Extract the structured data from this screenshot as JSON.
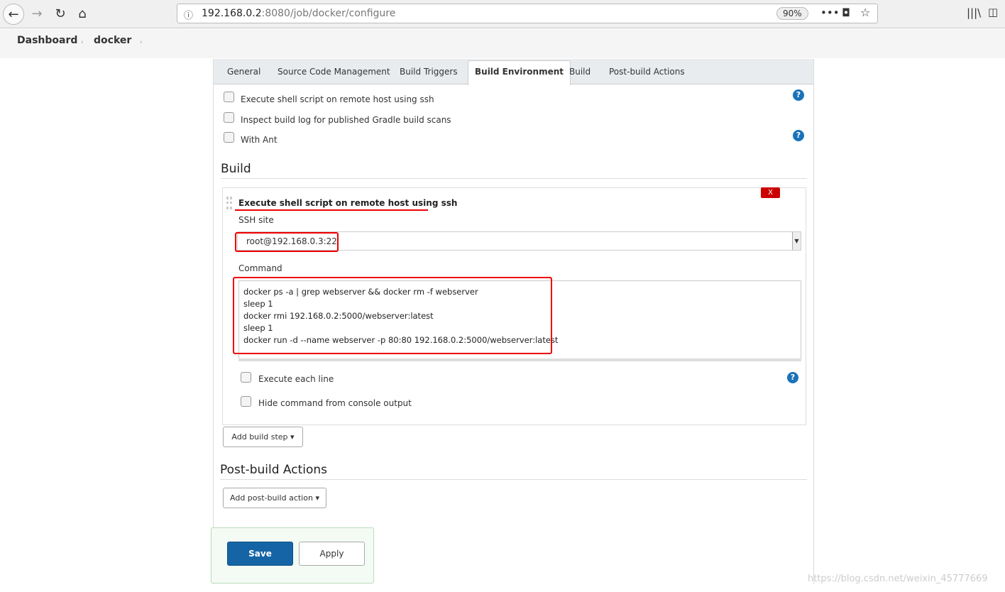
{
  "browser": {
    "url_host": "192.168.0.2",
    "url_path": ":8080/job/docker/configure",
    "zoom": "90%"
  },
  "breadcrumb": [
    "Dashboard",
    "docker"
  ],
  "tabs": [
    "General",
    "Source Code Management",
    "Build Triggers",
    "Build Environment",
    "Build",
    "Post-build Actions"
  ],
  "build_env": {
    "options": [
      "Execute shell script on remote host using ssh",
      "Inspect build log for published Gradle build scans",
      "With Ant"
    ]
  },
  "build": {
    "heading": "Build",
    "step_title": "Execute shell script on remote host using ssh",
    "delete_label": "X",
    "ssh_site_label": "SSH site",
    "ssh_site_value": "root@192.168.0.3:22",
    "command_label": "Command",
    "command": "docker ps -a | grep webserver && docker rm -f webserver\nsleep 1\ndocker rmi 192.168.0.2:5000/webserver:latest\nsleep 1\ndocker run -d --name webserver -p 80:80 192.168.0.2:5000/webserver:latest",
    "execute_each_line": "Execute each line",
    "hide_command": "Hide command from console output",
    "add_step": "Add build step"
  },
  "post": {
    "heading": "Post-build Actions",
    "add_action": "Add post-build action"
  },
  "actions": {
    "save": "Save",
    "apply": "Apply"
  },
  "watermark": "https://blog.csdn.net/weixin_45777669"
}
